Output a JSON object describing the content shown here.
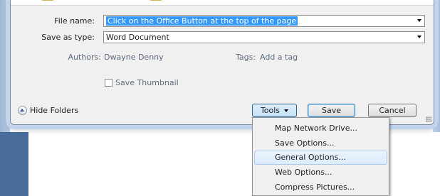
{
  "dialog": {
    "file_name_label": "File name:",
    "file_name_value": "Click on the Office Button at the top of the page",
    "save_as_type_label": "Save as type:",
    "save_as_type_value": "Word Document",
    "authors_label": "Authors:",
    "authors_value": "Dwayne Denny",
    "tags_label": "Tags:",
    "tags_value": "Add a tag",
    "save_thumbnail_label": "Save Thumbnail",
    "save_thumbnail_checked": false,
    "hide_folders_label": "Hide Folders",
    "tools_label": "Tools",
    "save_label": "Save",
    "cancel_label": "Cancel"
  },
  "tools_menu": {
    "items": [
      {
        "label": "Map Network Drive..."
      },
      {
        "label": "Save Options..."
      },
      {
        "label": "General Options...",
        "highlighted": true
      },
      {
        "label": "Web Options..."
      },
      {
        "label": "Compress Pictures..."
      }
    ]
  },
  "colors": {
    "selection": "#3399ff",
    "link": "#1f5fbf",
    "menu_highlight": "#dcebfc"
  },
  "icons": {
    "hide_folders": "chevron-up-circle-icon",
    "dropdown": "chevron-down-icon",
    "resize": "resize-grip-icon"
  }
}
